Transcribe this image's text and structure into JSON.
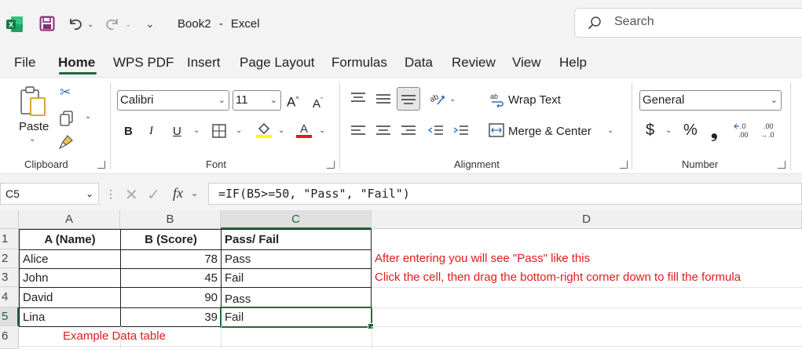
{
  "app": {
    "doc_title": "Book2",
    "separator": "-",
    "app_name": "Excel",
    "search_placeholder": "Search"
  },
  "menu": {
    "tabs": [
      "File",
      "Home",
      "WPS PDF",
      "Insert",
      "Page Layout",
      "Formulas",
      "Data",
      "Review",
      "View",
      "Help"
    ],
    "active": "Home"
  },
  "ribbon": {
    "clipboard": {
      "paste_label": "Paste",
      "group_label": "Clipboard"
    },
    "font": {
      "font_name": "Calibri",
      "font_size": "11",
      "bold": "B",
      "italic": "I",
      "underline": "U",
      "group_label": "Font",
      "highlight_color": "#ffff00",
      "font_color": "#e01b1b"
    },
    "alignment": {
      "wrap_text": "Wrap Text",
      "merge_center": "Merge & Center",
      "group_label": "Alignment"
    },
    "number": {
      "format": "General",
      "currency": "$",
      "percent": "%",
      "comma": "❟",
      "group_label": "Number"
    }
  },
  "formula_bar": {
    "name_box": "C5",
    "fx": "fx",
    "formula": "=IF(B5>=50, \"Pass\", \"Fail\")"
  },
  "sheet": {
    "columns": [
      "A",
      "B",
      "C",
      "D"
    ],
    "rows": [
      "1",
      "2",
      "3",
      "4",
      "5",
      "6"
    ],
    "headers": [
      "A (Name)",
      "B (Score)",
      "Pass/ Fail"
    ],
    "data": [
      {
        "name": "Alice",
        "score": "78",
        "result": "Pass"
      },
      {
        "name": "John",
        "score": "45",
        "result": "Fail"
      },
      {
        "name": "David",
        "score": "90",
        "result": "Pass"
      },
      {
        "name": "Lina",
        "score": "39",
        "result": "Fail"
      }
    ],
    "note_d2": "After entering you will see \"Pass\" like this",
    "note_d3": "Click the cell, then drag the bottom-right corner down to fill the formula",
    "caption": "Example Data table",
    "active_cell": "C5"
  },
  "colors": {
    "excel_green": "#1e6b3a",
    "annotation_red": "#e01b1b"
  }
}
